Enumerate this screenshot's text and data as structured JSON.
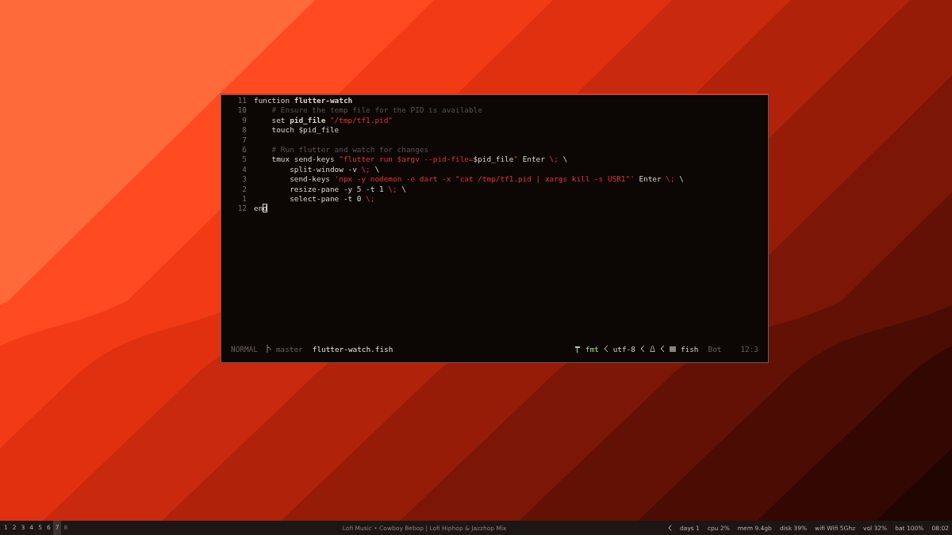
{
  "editor": {
    "lines": [
      {
        "number": "11",
        "tokens": [
          {
            "kind": "text",
            "text": "function "
          },
          {
            "kind": "name",
            "text": "flutter-watch"
          }
        ]
      },
      {
        "number": "10",
        "tokens": [
          {
            "kind": "comment",
            "text": "    # Ensure the temp file for the PID is available"
          }
        ]
      },
      {
        "number": "9",
        "tokens": [
          {
            "kind": "text",
            "text": "    set "
          },
          {
            "kind": "name",
            "text": "pid_file"
          },
          {
            "kind": "string",
            "text": " \"/tmp/tf1.pid\""
          }
        ]
      },
      {
        "number": "8",
        "tokens": [
          {
            "kind": "text",
            "text": "    touch $pid_file"
          }
        ]
      },
      {
        "number": "7"
      },
      {
        "number": "6",
        "tokens": [
          {
            "kind": "comment",
            "text": "    # Run flutter and watch for changes"
          }
        ]
      },
      {
        "number": "5",
        "tokens": [
          {
            "kind": "text",
            "text": "    tmux send-keys "
          },
          {
            "kind": "string",
            "text": "\"flutter run $argv --pid-file="
          },
          {
            "kind": "text",
            "text": "$pid_file"
          },
          {
            "kind": "string",
            "text": "\""
          },
          {
            "kind": "text",
            "text": " Enter "
          },
          {
            "kind": "string",
            "text": "\\;"
          },
          {
            "kind": "text",
            "text": " \\"
          }
        ]
      },
      {
        "number": "4",
        "tokens": [
          {
            "kind": "text",
            "text": "        split-window -v "
          },
          {
            "kind": "string",
            "text": "\\;"
          },
          {
            "kind": "text",
            "text": " \\"
          }
        ]
      },
      {
        "number": "3",
        "tokens": [
          {
            "kind": "text",
            "text": "        send-keys "
          },
          {
            "kind": "string",
            "text": "'npx -y nodemon -e dart -x \"cat /tmp/tf1.pid | xargs kill -s USR1\"'"
          },
          {
            "kind": "text",
            "text": " Enter "
          },
          {
            "kind": "string",
            "text": "\\;"
          },
          {
            "kind": "text",
            "text": " \\"
          }
        ]
      },
      {
        "number": "2",
        "tokens": [
          {
            "kind": "text",
            "text": "        resize-pane -y 5 -t 1 "
          },
          {
            "kind": "string",
            "text": "\\;"
          },
          {
            "kind": "text",
            "text": " \\"
          }
        ]
      },
      {
        "number": "1",
        "tokens": [
          {
            "kind": "text",
            "text": "        select-pane -t 0 "
          },
          {
            "kind": "string",
            "text": "\\;"
          }
        ]
      },
      {
        "number": "12",
        "tokens": [
          {
            "kind": "text",
            "text": "en"
          },
          {
            "kind": "cursor",
            "text": "d"
          }
        ]
      }
    ]
  },
  "statusline": {
    "mode": "NORMAL",
    "branch": "master",
    "file": "flutter-watch.fish",
    "formatter": "fmt",
    "encoding": "utf-8",
    "filetype": "fish",
    "position": "Bot",
    "cursor": "12:3"
  },
  "taskbar": {
    "workspaces": [
      {
        "label": "1",
        "selected": false,
        "empty": false
      },
      {
        "label": "2",
        "selected": false,
        "empty": false
      },
      {
        "label": "3",
        "selected": false,
        "empty": false
      },
      {
        "label": "4",
        "selected": false,
        "empty": false
      },
      {
        "label": "5",
        "selected": false,
        "empty": false
      },
      {
        "label": "6",
        "selected": false,
        "empty": false
      },
      {
        "label": "7",
        "selected": true,
        "empty": false
      },
      {
        "label": "8",
        "selected": false,
        "empty": true
      }
    ],
    "title": "Lofi Music • Cowboy Bebop | Lofi Hiphop & Jazzhop Mix",
    "stats": [
      "days 1",
      "cpu 2%",
      "mem 9.4gb",
      "disk 39%",
      "wifi Wifi 5Ghz",
      "vol 32%",
      "bat 100%",
      "08:02"
    ]
  }
}
